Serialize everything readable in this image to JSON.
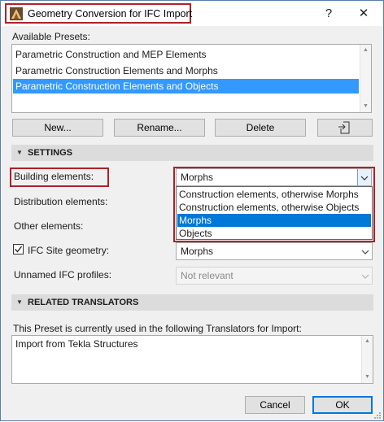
{
  "window": {
    "title": "Geometry Conversion for IFC Import",
    "help_label": "?",
    "close_label": "✕"
  },
  "presets": {
    "label": "Available Presets:",
    "items": [
      "Parametric Construction and MEP Elements",
      "Parametric Construction Elements and Morphs",
      "Parametric Construction Elements and Objects"
    ],
    "selected_index": 2
  },
  "buttons": {
    "new": "New...",
    "rename": "Rename...",
    "delete": "Delete",
    "ok": "OK",
    "cancel": "Cancel"
  },
  "settings": {
    "header": "SETTINGS",
    "building_elements": {
      "label": "Building elements:",
      "value": "Morphs"
    },
    "distribution_elements": {
      "label": "Distribution elements:"
    },
    "other_elements": {
      "label": "Other elements:"
    },
    "ifc_site": {
      "label": "IFC Site geometry:",
      "value": "Morphs",
      "checked": true
    },
    "unnamed_profiles": {
      "label": "Unnamed IFC profiles:",
      "value": "Not relevant"
    },
    "dropdown_options": [
      "Construction elements, otherwise Morphs",
      "Construction elements, otherwise Objects",
      "Morphs",
      "Objects"
    ],
    "dropdown_selected_index": 2
  },
  "translators": {
    "header": "RELATED TRANSLATORS",
    "description": "This Preset is currently used in the following Translators for Import:",
    "items": [
      "Import from Tekla Structures"
    ]
  },
  "colors": {
    "highlight_border": "#b0202a",
    "selection": "#3399ff",
    "dropdown_selection": "#0078d7"
  }
}
